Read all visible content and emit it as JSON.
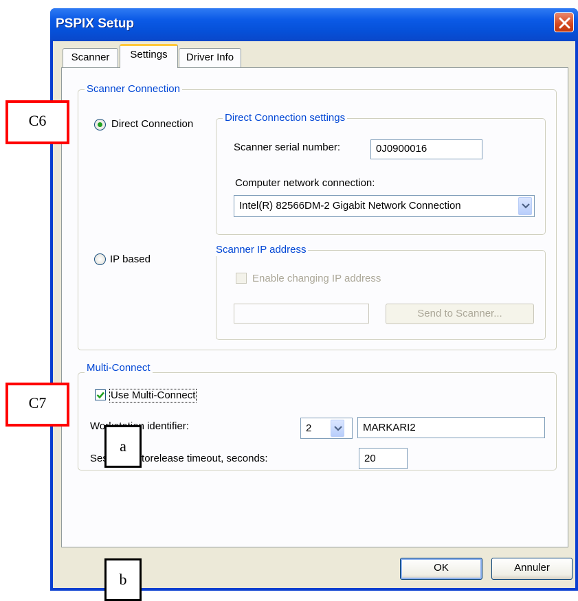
{
  "window": {
    "title": "PSPIX Setup",
    "close_icon": "close-icon"
  },
  "tabs": [
    {
      "label": "Scanner",
      "active": false
    },
    {
      "label": "Settings",
      "active": true
    },
    {
      "label": "Driver Info",
      "active": false
    }
  ],
  "scanner_connection": {
    "legend": "Scanner Connection",
    "direct_radio": {
      "label": "Direct  Connection",
      "selected": true
    },
    "ip_radio": {
      "label": "IP based",
      "selected": false
    },
    "direct_settings": {
      "legend": "Direct Connection settings",
      "serial_label": "Scanner serial number:",
      "serial_value": "0J0900016",
      "network_label": "Computer network connection:",
      "network_value": "Intel(R) 82566DM-2 Gigabit Network Connection"
    },
    "ip_settings": {
      "legend": "Scanner IP address",
      "enable_label": "Enable changing IP address",
      "enable_checked": false,
      "ip_value": "",
      "send_button": "Send to Scanner..."
    }
  },
  "multi_connect": {
    "legend": "Multi-Connect",
    "use_label": "Use Multi-Connect",
    "use_checked": true,
    "workstation_label": "Workstation identifier:",
    "workstation_number": "2",
    "workstation_name": "MARKARI2",
    "timeout_label": "Session Autorelease timeout, seconds:",
    "timeout_value": "20"
  },
  "buttons": {
    "ok": "OK",
    "cancel": "Annuler"
  },
  "annotations": {
    "c6": "C6",
    "c7": "C7",
    "a": "a",
    "b": "b"
  },
  "colors": {
    "titlebar": "#0b5ae6",
    "group_legend": "#0046d5",
    "callout_red": "#ff0000",
    "dialog_face": "#ece9d8"
  }
}
